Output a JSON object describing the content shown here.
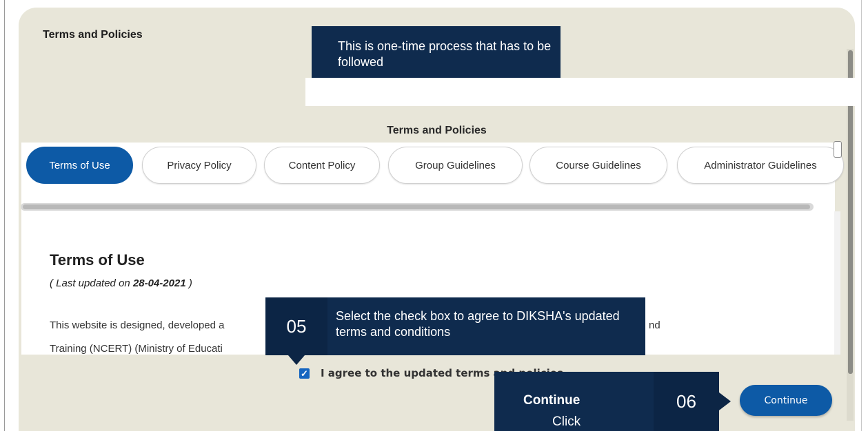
{
  "modal": {
    "title": "Terms and Policies",
    "section_heading": "Terms and Policies"
  },
  "callouts": {
    "top_note": "This is one-time process that has to be followed",
    "step5": {
      "number": "05",
      "text": "Select the check box to agree to DIKSHA's updated terms and conditions"
    },
    "step6": {
      "text_prefix": "Click ",
      "text_bold": "Continue",
      "number": "06"
    }
  },
  "tabs": [
    {
      "label": "Terms of Use",
      "active": true
    },
    {
      "label": "Privacy Policy",
      "active": false
    },
    {
      "label": "Content Policy",
      "active": false
    },
    {
      "label": "Group Guidelines",
      "active": false
    },
    {
      "label": "Course Guidelines",
      "active": false
    },
    {
      "label": "Administrator Guidelines",
      "active": false
    }
  ],
  "content": {
    "title": "Terms of Use",
    "updated_prefix": "( Last updated on ",
    "updated_date": "28-04-2021",
    "updated_suffix": " )",
    "para1": "This website is designed, developed a",
    "para1_tail": "nd",
    "para2": "Training (NCERT) (Ministry of Educati"
  },
  "agreement": {
    "checked": true,
    "label": "I agree to the updated terms and policies"
  },
  "actions": {
    "continue_label": "Continue"
  },
  "colors": {
    "accent": "#0d5aa6",
    "callout_bg": "#0f2b4e",
    "modal_bg": "#e8e6d9"
  }
}
